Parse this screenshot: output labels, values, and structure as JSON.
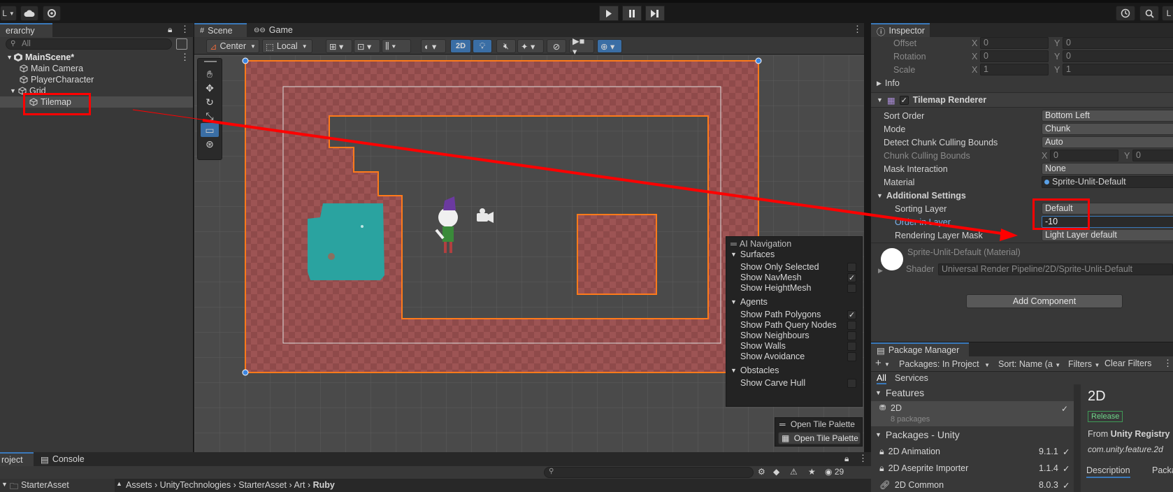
{
  "toolbar": {
    "account_label": "L",
    "right_initial": "L"
  },
  "hierarchy": {
    "tab": "erarchy",
    "search_placeholder": "All",
    "scene": "MainScene*",
    "items": [
      "Main Camera",
      "PlayerCharacter",
      "Grid",
      "Tilemap"
    ]
  },
  "scene": {
    "tabs": [
      "Scene",
      "Game"
    ],
    "pivot": "Center",
    "space": "Local",
    "mode2d": "2D"
  },
  "ai_nav": {
    "title": "AI Navigation",
    "surfaces": "Surfaces",
    "surface_items": [
      {
        "label": "Show Only Selected",
        "checked": false
      },
      {
        "label": "Show NavMesh",
        "checked": true
      },
      {
        "label": "Show HeightMesh",
        "checked": false
      }
    ],
    "agents": "Agents",
    "agent_items": [
      {
        "label": "Show Path Polygons",
        "checked": true
      },
      {
        "label": "Show Path Query Nodes",
        "checked": false
      },
      {
        "label": "Show Neighbours",
        "checked": false
      },
      {
        "label": "Show Walls",
        "checked": false
      },
      {
        "label": "Show Avoidance",
        "checked": false
      }
    ],
    "obstacles": "Obstacles",
    "obstacle_items": [
      {
        "label": "Show Carve Hull",
        "checked": false
      }
    ],
    "tile_palette_title": "Open Tile Palette",
    "tile_palette_button": "Open Tile Palette"
  },
  "inspector": {
    "tab": "Inspector",
    "offset": "Offset",
    "rotation": "Rotation",
    "scale": "Scale",
    "info": "Info",
    "x": "X",
    "y": "Y",
    "offset_x": "0",
    "offset_y": "0",
    "rotation_x": "0",
    "rotation_y": "0",
    "scale_x": "1",
    "scale_y": "1",
    "component": "Tilemap Renderer",
    "sort_order_label": "Sort Order",
    "sort_order": "Bottom Left",
    "mode_label": "Mode",
    "mode": "Chunk",
    "detect_label": "Detect Chunk Culling Bounds",
    "detect": "Auto",
    "chunk_label": "Chunk Culling Bounds",
    "chunk_x": "0",
    "chunk_y": "0",
    "mask_label": "Mask Interaction",
    "mask": "None",
    "material_label": "Material",
    "material": "Sprite-Unlit-Default",
    "additional": "Additional Settings",
    "sorting_layer_label": "Sorting Layer",
    "sorting_layer": "Default",
    "order_label": "Order in Layer",
    "order": "-10",
    "rendering_label": "Rendering Layer Mask",
    "rendering": "Light Layer default",
    "mat_name": "Sprite-Unlit-Default (Material)",
    "shader_label": "Shader",
    "shader": "Universal Render Pipeline/2D/Sprite-Unlit-Default",
    "add_component": "Add Component"
  },
  "package_manager": {
    "tab": "Package Manager",
    "packages_dd": "Packages: In Project",
    "sort_dd": "Sort: Name (a",
    "filters": "Filters",
    "clear_filters": "Clear Filters",
    "tabs": [
      "All",
      "Services"
    ],
    "features_header": "Features",
    "feature_name": "2D",
    "feature_sub": "8 packages",
    "packages_header": "Packages - Unity",
    "packages": [
      {
        "name": "2D Animation",
        "version": "9.1.1"
      },
      {
        "name": "2D Aseprite Importer",
        "version": "1.1.4"
      },
      {
        "name": "2D Common",
        "version": "8.0.3"
      }
    ],
    "detail_title": "2D",
    "detail_badge": "Release",
    "detail_from_prefix": "From",
    "detail_from": "Unity Registry",
    "detail_id": "com.unity.feature.2d",
    "detail_tabs": [
      "Description",
      "Packag"
    ]
  },
  "project": {
    "tabs": [
      "roject",
      "Console"
    ],
    "count": "29",
    "breadcrumb": [
      "Assets",
      "UnityTechnologies",
      "StarterAsset",
      "Art",
      "Ruby"
    ],
    "folder": "StarterAsset"
  },
  "colors": {
    "accent": "#3a79bb",
    "highlight": "#ff0000",
    "tile_selection": "#ff7a1a"
  }
}
